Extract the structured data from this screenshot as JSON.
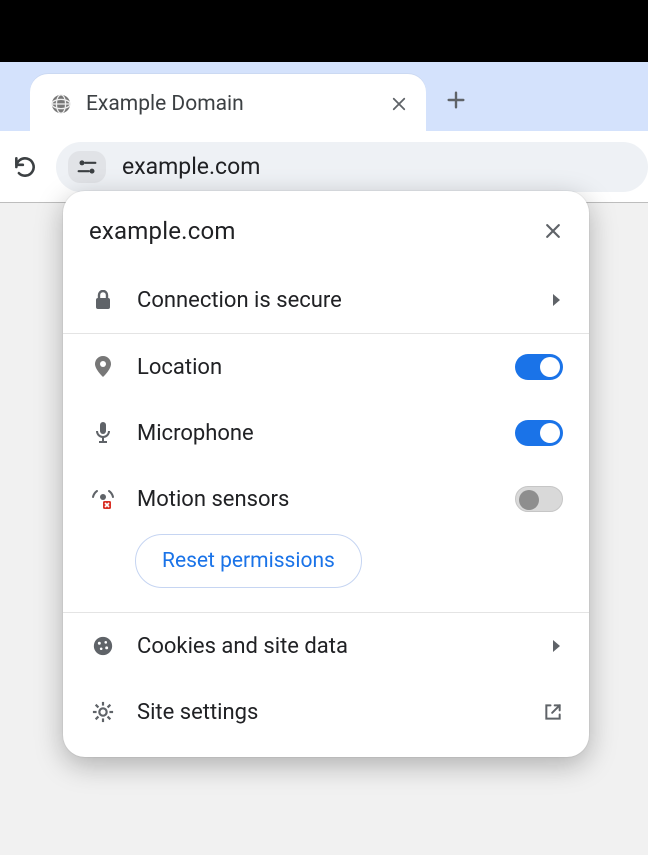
{
  "tab": {
    "title": "Example Domain"
  },
  "omnibox": {
    "url": "example.com"
  },
  "popup": {
    "host": "example.com",
    "connection_label": "Connection is secure",
    "permissions": {
      "location": {
        "label": "Location",
        "on": true
      },
      "microphone": {
        "label": "Microphone",
        "on": true
      },
      "motion": {
        "label": "Motion sensors",
        "on": false
      }
    },
    "reset_label": "Reset permissions",
    "cookies_label": "Cookies and site data",
    "site_settings_label": "Site settings"
  }
}
